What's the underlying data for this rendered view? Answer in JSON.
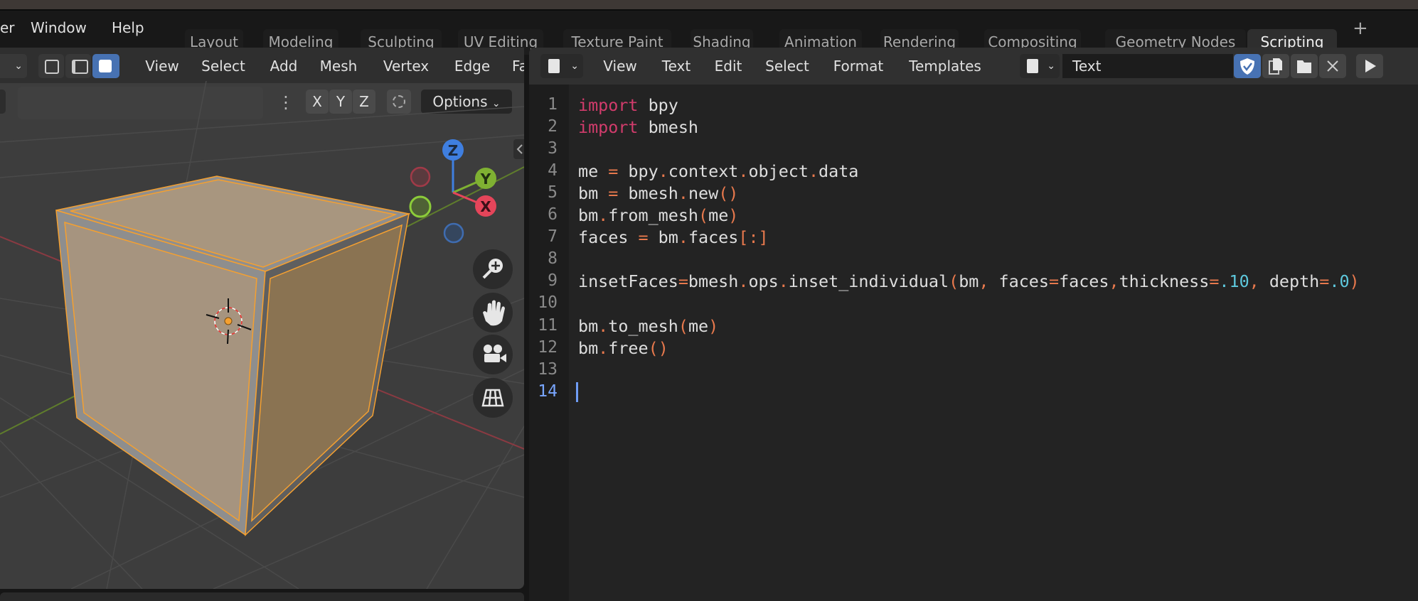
{
  "topbar": {
    "menus": [
      "er",
      "Window",
      "Help"
    ],
    "tabs": [
      "Layout",
      "Modeling",
      "Sculpting",
      "UV Editing",
      "Texture Paint",
      "Shading",
      "Animation",
      "Rendering",
      "Compositing",
      "Geometry Nodes",
      "Scripting"
    ],
    "active_tab": "Scripting",
    "add_tab_label": "+"
  },
  "viewport": {
    "menus": [
      "View",
      "Select",
      "Add",
      "Mesh",
      "Vertex",
      "Edge",
      "Fa"
    ],
    "select_mode": "face",
    "axis_buttons": [
      "X",
      "Y",
      "Z"
    ],
    "options_label": "Options",
    "gizmo_labels": {
      "z": "Z",
      "y": "Y",
      "x": "X"
    },
    "nav_icons": [
      "zoom-icon",
      "hand-pan-icon",
      "camera-icon",
      "grid-perspective-icon"
    ],
    "colors": {
      "selection": "#f5a030",
      "x_axis": "#e5455a",
      "y_axis": "#7fb132",
      "z_axis": "#3f7fe0"
    }
  },
  "text_editor": {
    "menus": [
      "View",
      "Text",
      "Edit",
      "Select",
      "Format",
      "Templates"
    ],
    "datablock_name": "Text",
    "current_line": 14,
    "lines": [
      [
        {
          "t": "import",
          "c": "kw"
        },
        {
          "t": " bpy"
        }
      ],
      [
        {
          "t": "import",
          "c": "kw"
        },
        {
          "t": " bmesh"
        }
      ],
      [],
      [
        {
          "t": "me "
        },
        {
          "t": "=",
          "c": "op"
        },
        {
          "t": " bpy"
        },
        {
          "t": ".",
          "c": "op"
        },
        {
          "t": "context"
        },
        {
          "t": ".",
          "c": "op"
        },
        {
          "t": "object"
        },
        {
          "t": ".",
          "c": "op"
        },
        {
          "t": "data"
        }
      ],
      [
        {
          "t": "bm "
        },
        {
          "t": "=",
          "c": "op"
        },
        {
          "t": " bmesh"
        },
        {
          "t": ".",
          "c": "op"
        },
        {
          "t": "new"
        },
        {
          "t": "()",
          "c": "op"
        }
      ],
      [
        {
          "t": "bm"
        },
        {
          "t": ".",
          "c": "op"
        },
        {
          "t": "from_mesh"
        },
        {
          "t": "(",
          "c": "op"
        },
        {
          "t": "me"
        },
        {
          "t": ")",
          "c": "op"
        }
      ],
      [
        {
          "t": "faces "
        },
        {
          "t": "=",
          "c": "op"
        },
        {
          "t": " bm"
        },
        {
          "t": ".",
          "c": "op"
        },
        {
          "t": "faces"
        },
        {
          "t": "[:]",
          "c": "op"
        }
      ],
      [],
      [
        {
          "t": "insetFaces"
        },
        {
          "t": "=",
          "c": "op"
        },
        {
          "t": "bmesh"
        },
        {
          "t": ".",
          "c": "op"
        },
        {
          "t": "ops"
        },
        {
          "t": ".",
          "c": "op"
        },
        {
          "t": "inset_individual"
        },
        {
          "t": "(",
          "c": "op"
        },
        {
          "t": "bm"
        },
        {
          "t": ",",
          "c": "op"
        },
        {
          "t": " faces"
        },
        {
          "t": "=",
          "c": "op"
        },
        {
          "t": "faces"
        },
        {
          "t": ",",
          "c": "op"
        },
        {
          "t": "thickness"
        },
        {
          "t": "=",
          "c": "op"
        },
        {
          "t": ".10",
          "c": "num"
        },
        {
          "t": ",",
          "c": "op"
        },
        {
          "t": " depth"
        },
        {
          "t": "=",
          "c": "op"
        },
        {
          "t": ".0",
          "c": "num"
        },
        {
          "t": ")",
          "c": "op"
        }
      ],
      [],
      [
        {
          "t": "bm"
        },
        {
          "t": ".",
          "c": "op"
        },
        {
          "t": "to_mesh"
        },
        {
          "t": "(",
          "c": "op"
        },
        {
          "t": "me"
        },
        {
          "t": ")",
          "c": "op"
        }
      ],
      [
        {
          "t": "bm"
        },
        {
          "t": ".",
          "c": "op"
        },
        {
          "t": "free"
        },
        {
          "t": "()",
          "c": "op"
        }
      ],
      [],
      []
    ],
    "colors": {
      "keyword": "#d23c6c",
      "operator": "#e8794d",
      "number": "#5ec9de",
      "line_number_current": "#79a6ff"
    }
  }
}
